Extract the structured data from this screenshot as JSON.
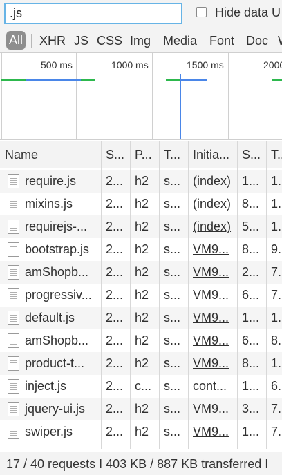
{
  "filter": {
    "value": ".js",
    "hide_data_urls_label": "Hide data U"
  },
  "type_filters": [
    "All",
    "XHR",
    "JS",
    "CSS",
    "Img",
    "Media",
    "Font",
    "Doc",
    "W"
  ],
  "overview": {
    "ticks": [
      "500 ms",
      "1000 ms",
      "1500 ms",
      "2000"
    ]
  },
  "columns": [
    "Name",
    "S...",
    "P...",
    "T...",
    "Initia...",
    "S...",
    "T..."
  ],
  "rows": [
    {
      "name": "require.js",
      "status": "2...",
      "protocol": "h2",
      "type": "s...",
      "initiator": "(index)",
      "size": "1...",
      "time": "1."
    },
    {
      "name": "mixins.js",
      "status": "2...",
      "protocol": "h2",
      "type": "s...",
      "initiator": "(index)",
      "size": "8...",
      "time": "1."
    },
    {
      "name": "requirejs-...",
      "status": "2...",
      "protocol": "h2",
      "type": "s...",
      "initiator": "(index)",
      "size": "5...",
      "time": "1."
    },
    {
      "name": "bootstrap.js",
      "status": "2...",
      "protocol": "h2",
      "type": "s...",
      "initiator": "VM9...",
      "size": "8...",
      "time": "9."
    },
    {
      "name": "amShopb...",
      "status": "2...",
      "protocol": "h2",
      "type": "s...",
      "initiator": "VM9...",
      "size": "2...",
      "time": "7."
    },
    {
      "name": "progressiv...",
      "status": "2...",
      "protocol": "h2",
      "type": "s...",
      "initiator": "VM9...",
      "size": "6...",
      "time": "7."
    },
    {
      "name": "default.js",
      "status": "2...",
      "protocol": "h2",
      "type": "s...",
      "initiator": "VM9...",
      "size": "1...",
      "time": "1."
    },
    {
      "name": "amShopb...",
      "status": "2...",
      "protocol": "h2",
      "type": "s...",
      "initiator": "VM9...",
      "size": "6...",
      "time": "8."
    },
    {
      "name": "product-t...",
      "status": "2...",
      "protocol": "h2",
      "type": "s...",
      "initiator": "VM9...",
      "size": "8...",
      "time": "1."
    },
    {
      "name": "inject.js",
      "status": "2...",
      "protocol": "c...",
      "type": "s...",
      "initiator": "cont...",
      "size": "1...",
      "time": "6."
    },
    {
      "name": "jquery-ui.js",
      "status": "2...",
      "protocol": "h2",
      "type": "s...",
      "initiator": "VM9...",
      "size": "3...",
      "time": "7."
    },
    {
      "name": "swiper.js",
      "status": "2...",
      "protocol": "h2",
      "type": "s...",
      "initiator": "VM9...",
      "size": "1...",
      "time": "7."
    }
  ],
  "status_bar": {
    "text": "17 / 40 requests  I  403 KB / 887 KB transferred  I"
  },
  "colors": {
    "accent": "#67b4e6",
    "bar_green": "#2db84d",
    "bar_blue": "#4a86e8"
  }
}
